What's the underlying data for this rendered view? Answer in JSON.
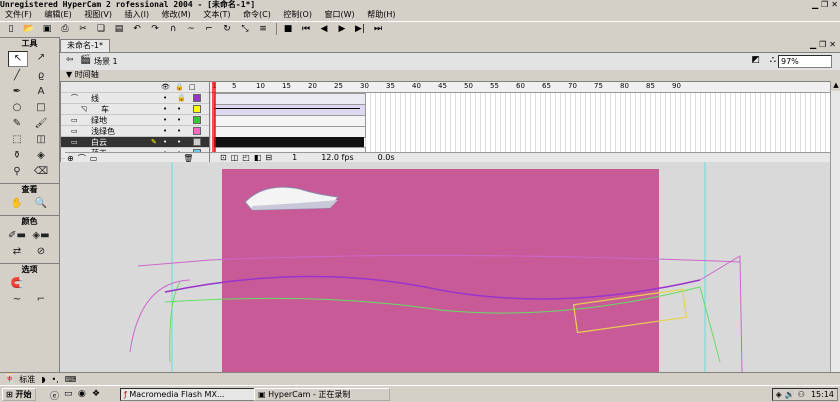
{
  "window": {
    "title_overlay": "Unregistered HyperCam 2",
    "title_rest": "rofessional 2004 - [未命名-1*]"
  },
  "menu": [
    "文件(F)",
    "编辑(E)",
    "视图(V)",
    "插入(I)",
    "修改(M)",
    "文本(T)",
    "命令(C)",
    "控制(O)",
    "窗口(W)",
    "帮助(H)"
  ],
  "toolbar_icons": [
    "new-icon",
    "open-icon",
    "save-icon",
    "print-icon",
    "cut-icon",
    "copy-icon",
    "paste-icon",
    "undo-icon",
    "redo-icon",
    "snap-icon",
    "smooth-icon",
    "straighten-icon",
    "rotate-icon",
    "scale-icon",
    "align-icon",
    "stop-icon",
    "rewind-icon",
    "step-back-icon",
    "play-icon",
    "step-forward-icon",
    "end-icon"
  ],
  "tools_panel": {
    "title": "工具",
    "view_label": "查看",
    "colors_label": "颜色",
    "options_label": "选项"
  },
  "document": {
    "tab": "未命名-1*",
    "scene": "场景 1",
    "zoom": "97%"
  },
  "timeline": {
    "label": "时间轴",
    "ticks": [
      "1",
      "5",
      "10",
      "15",
      "20",
      "25",
      "30",
      "35",
      "40",
      "45",
      "50",
      "55",
      "60",
      "65",
      "70",
      "75",
      "80",
      "85",
      "90"
    ],
    "layers": [
      {
        "name": "线",
        "color": "#9933cc",
        "active": false
      },
      {
        "name": "车",
        "color": "#ffff00",
        "active": false
      },
      {
        "name": "绿地",
        "color": "#33cc33",
        "active": false
      },
      {
        "name": "浅绿色",
        "color": "#ff66cc",
        "active": false
      },
      {
        "name": "白云",
        "color": "#cccccc",
        "active": true
      },
      {
        "name": "蓝天",
        "color": "#66ccff",
        "active": false
      }
    ],
    "current_frame": "1",
    "fps": "12.0 fps",
    "time": "0.0s"
  },
  "bottom_panel": {
    "label": "标准"
  },
  "taskbar": {
    "start": "开始",
    "tasks": [
      "Macromedia Flash MX...",
      "HyperCam - 正在录制"
    ],
    "clock": "15:14"
  },
  "colors": {
    "stage": "#c95a98",
    "active_layer": "#333333"
  }
}
